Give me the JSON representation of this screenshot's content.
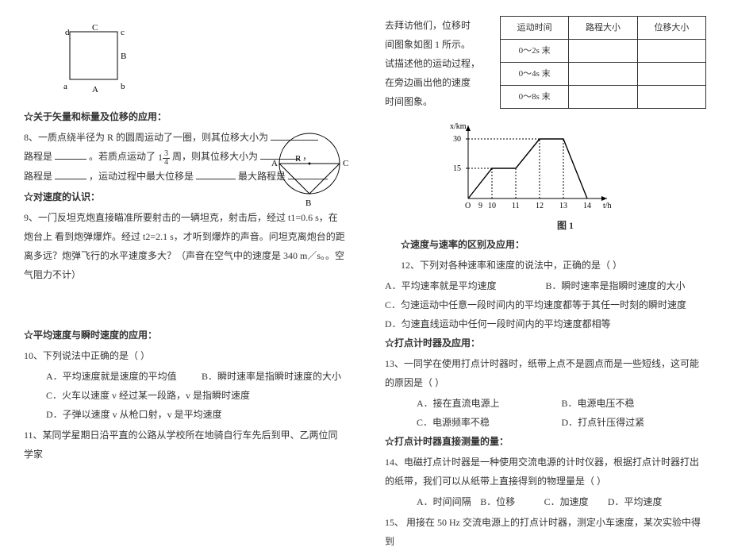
{
  "left": {
    "square": {
      "d": "d",
      "c": "c",
      "C": "C",
      "B": "B",
      "a": "a",
      "A": "A",
      "b": "b"
    },
    "sec1_title": "☆关于矢量和标量及位移的应用：",
    "q8": {
      "prefix": "8、一质点绕半径为 R 的圆周运动了一圈，则其位移大小为",
      "l2_a": "路程是",
      "l2_b": "。若质点运动了",
      "l2_c": "周，则其位移大小为",
      "l2_d": "，",
      "l3_a": "路程是",
      "l3_b": "，运动过程中最大位移是",
      "l3_c": "最大路程是",
      "frac_top": "3",
      "frac_bot": "4",
      "frac_int": "1"
    },
    "sec2_title": "☆对速度的认识：",
    "q9": "9、一门反坦克炮直接瞄准所要射击的一辆坦克，射击后，经过 t1=0.6 s，在炮台上     看到炮弹爆炸。经过 t2=2.1 s，才听到爆炸的声音。问坦克离炮台的距离多远？炮弹飞行的水平速度多大？（声音在空气中的速度是 340 m／s。。空气阻力不计）",
    "sec3_title": "☆平均速度与瞬时速度的应用：",
    "q10_stem": "10、下列说法中正确的是（     ）",
    "q10_a": "A．平均速度就是速度的平均值",
    "q10_b": "B．瞬时速率是指瞬时速度的大小",
    "q10_c": "C．火车以速度 v 经过某一段路，v 是指瞬时速度",
    "q10_d": "D．子弹以速度 v 从枪口射，v 是平均速度",
    "q11": "11、某同学星期日沿平直的公路从学校所在地骑自行车先后到甲、乙两位同学家",
    "circle": {
      "A": "A",
      "B": "B",
      "C": "C",
      "R": "R"
    }
  },
  "right": {
    "para1_a": "去拜访他们，位移时",
    "para1_b": "间图象如图 1 所示。",
    "para1_c": "试描述他的运动过程，",
    "para1_d": "在旁边画出他的速度",
    "para1_e": "时间图象。",
    "table": {
      "h1": "运动时间",
      "h2": "路程大小",
      "h3": "位移大小",
      "r1": "0～2s 末",
      "r2": "0～4s 末",
      "r3": "0～8s 末"
    },
    "chart_caption": "图 1",
    "sec4_title": "☆速度与速率的区别及应用：",
    "q12_stem": "12、下列对各种速率和速度的说法中，正确的是（          ）",
    "q12_a": "A．平均速率就是平均速度",
    "q12_b": "B．瞬时速率是指瞬时速度的大小",
    "q12_c": "C．匀速运动中任意一段时间内的平均速度都等于其任一时刻的瞬时速度",
    "q12_d": "D．匀速直线运动中任何一段时间内的平均速度都相等",
    "sec5_title": "☆打点计时器及应用：",
    "q13_stem": "13、一同学在使用打点计时器时，纸带上点不是圆点而是一些短线，这可能的原因是（     ）",
    "q13_a": "A．接在直流电源上",
    "q13_b": "B．电源电压不稳",
    "q13_c": "C．电源频率不稳",
    "q13_d": "D．打点针压得过紧",
    "sec6_title": "☆打点计时器直接测量的量：",
    "q14_stem": "14、电磁打点计时器是一种使用交流电源的计时仪器，根据打点计时器打出的纸带，我们可以从纸带上直接得到的物理量是（     ）",
    "q14_a": "A．时间间隔",
    "q14_b": "B．位移",
    "q14_c": "C．加速度",
    "q14_d": "D．平均速度",
    "q15": "15、 用接在 50 Hz 交流电源上的打点计时器，测定小车速度，某次实验中得到"
  },
  "chart_data": {
    "type": "line",
    "xlabel": "t/h",
    "ylabel": "x/km",
    "x_ticks": [
      9,
      10,
      11,
      12,
      13,
      14
    ],
    "y_ticks": [
      15,
      30
    ],
    "segments": [
      {
        "from": [
          9,
          0
        ],
        "to": [
          10,
          15
        ]
      },
      {
        "from": [
          10,
          15
        ],
        "to": [
          11,
          15
        ]
      },
      {
        "from": [
          11,
          15
        ],
        "to": [
          12,
          30
        ]
      },
      {
        "from": [
          12,
          30
        ],
        "to": [
          13,
          30
        ]
      },
      {
        "from": [
          13,
          30
        ],
        "to": [
          14,
          0
        ]
      }
    ],
    "xlim": [
      9,
      14.5
    ],
    "ylim": [
      0,
      32
    ]
  }
}
